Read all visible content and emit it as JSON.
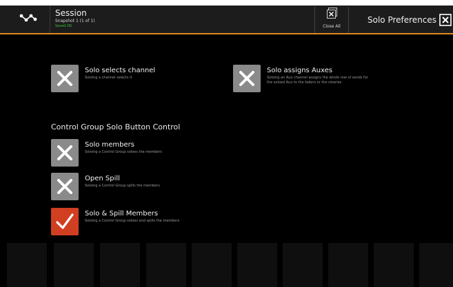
{
  "header": {
    "logo_icon": "mixer-nodes-icon",
    "session_title": "Session",
    "snapshot_text": "Snapshot 1 (1 of 1)",
    "status_text": "Saved OK",
    "close_all_label": "Close All",
    "close_all_icon": "close-all-windows-icon",
    "panel_title": "Solo Preferences",
    "close_icon": "close-icon",
    "accent_color": "#e38a1e"
  },
  "options": {
    "solo_selects_channel": {
      "label": "Solo selects channel",
      "description": "Soloing a channel selects it",
      "checked": false
    },
    "solo_assigns_auxes": {
      "label": "Solo assigns Auxes",
      "description_line1": "Soloing an Aux channel assigns the whole row of sends for",
      "description_line2": "the soloed Aux to the faders or the rotaries",
      "checked": false
    }
  },
  "control_group": {
    "heading": "Control Group Solo Button Control",
    "solo_members": {
      "label": "Solo members",
      "description": "Soloing a Control Group soloes the members",
      "checked": false
    },
    "open_spill": {
      "label": "Open Spill",
      "description": "Soloing a Control Group spills the members",
      "checked": false
    },
    "solo_spill_members": {
      "label": "Solo & Spill Members",
      "description": "Soloing a Control Group soloes and spills the members",
      "checked": true
    }
  },
  "colors": {
    "checkbox_off": "#8a8a8a",
    "checkbox_on": "#d13f22",
    "status_ok": "#39c23c"
  }
}
